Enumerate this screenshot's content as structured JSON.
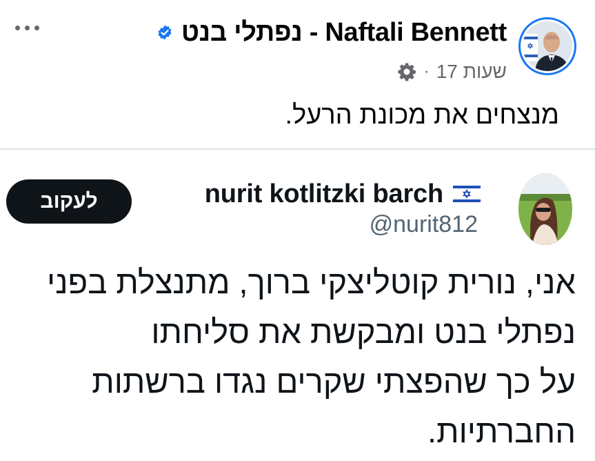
{
  "post": {
    "author": "נפתלי בנט - Naftali Bennett",
    "time": "17 שעות",
    "separator": "·",
    "text": "מנצחים את מכונת הרעל."
  },
  "tweet": {
    "name": "nurit kotlitzki barch",
    "handle": "@nurit812",
    "follow_label": "לעקוב",
    "body_lines": [
      "אני, נורית קוטליצקי ברוך, מתנצלת בפני",
      "נפתלי בנט ומבקשת את סליחתו",
      "על כך שהפצתי שקרים נגדו ברשתות",
      "החברתיות."
    ]
  },
  "icons": {
    "more": "more-options-icon",
    "verified": "verified-badge-icon",
    "privacy": "gear-icon",
    "flag": "israel-flag-icon"
  },
  "colors": {
    "fb_blue": "#1877f2",
    "secondary_text": "#65676b",
    "x_black": "#0f1419",
    "x_gray": "#536471"
  }
}
